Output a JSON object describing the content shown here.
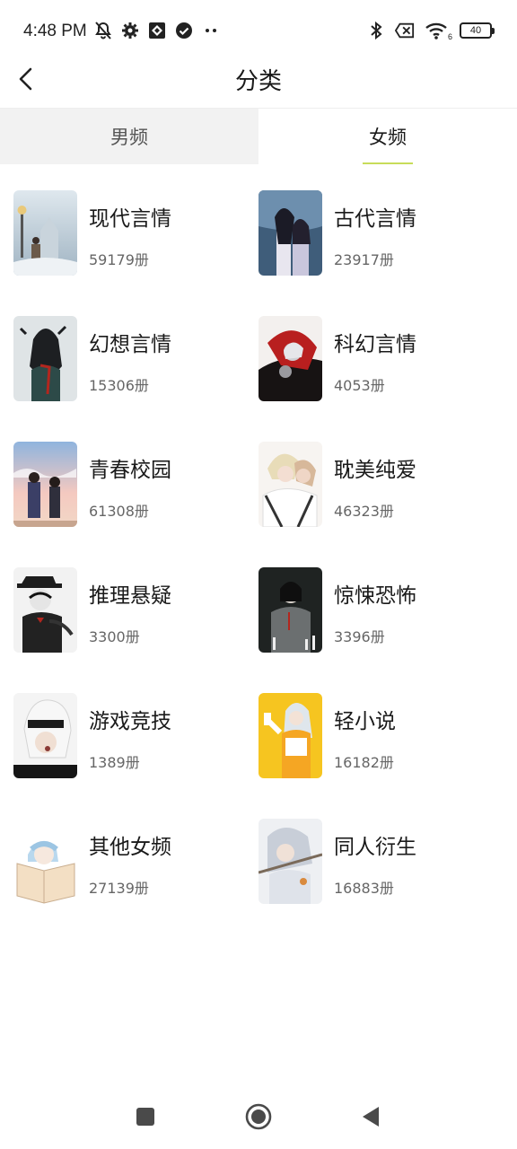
{
  "status_bar": {
    "time": "4:48 PM",
    "battery": "40",
    "wifi_badge": "6"
  },
  "header": {
    "title": "分类"
  },
  "tabs": [
    {
      "label": "男频",
      "selected": false
    },
    {
      "label": "女频",
      "selected": true
    }
  ],
  "categories": [
    {
      "name": "现代言情",
      "count": "59179册"
    },
    {
      "name": "古代言情",
      "count": "23917册"
    },
    {
      "name": "幻想言情",
      "count": "15306册"
    },
    {
      "name": "科幻言情",
      "count": "4053册"
    },
    {
      "name": "青春校园",
      "count": "61308册"
    },
    {
      "name": "耽美纯爱",
      "count": "46323册"
    },
    {
      "name": "推理悬疑",
      "count": "3300册"
    },
    {
      "name": "惊悚恐怖",
      "count": "3396册"
    },
    {
      "name": "游戏竞技",
      "count": "1389册"
    },
    {
      "name": "轻小说",
      "count": "16182册"
    },
    {
      "name": "其他女频",
      "count": "27139册"
    },
    {
      "name": "同人衍生",
      "count": "16883册"
    }
  ],
  "colors": {
    "tab_underline": "#c8dc5a",
    "inactive_tab_bg": "#f2f2f2"
  }
}
